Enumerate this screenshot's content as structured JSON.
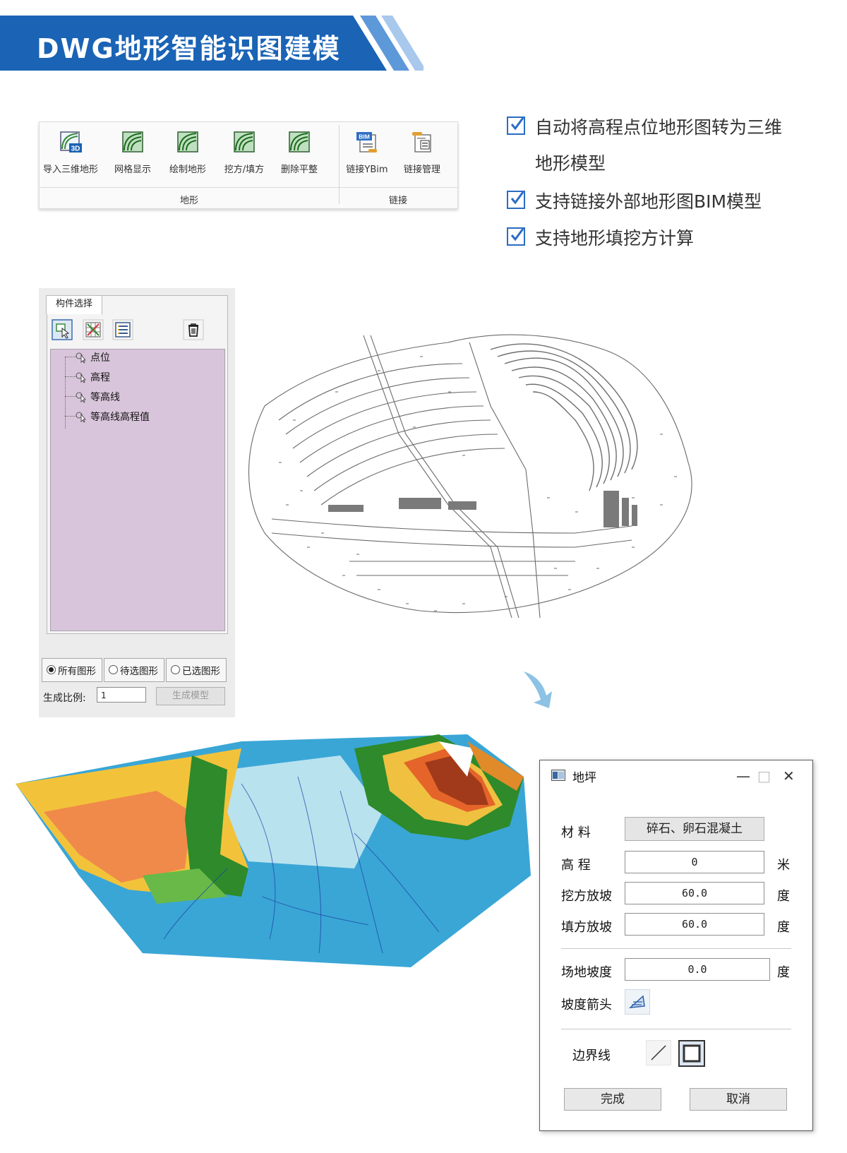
{
  "header": {
    "title": "DWG地形智能识图建模",
    "color": "#1a63b5"
  },
  "ribbon": {
    "groups": [
      {
        "label": "地形",
        "buttons": [
          {
            "label": "导入三维地形",
            "icon": "import-3d-terrain-icon"
          },
          {
            "label": "网格显示",
            "icon": "grid-display-icon"
          },
          {
            "label": "绘制地形",
            "icon": "draw-terrain-icon"
          },
          {
            "label": "挖方/填方",
            "icon": "cut-fill-icon"
          },
          {
            "label": "删除平整",
            "icon": "delete-leveling-icon"
          }
        ]
      },
      {
        "label": "链接",
        "buttons": [
          {
            "label": "链接YBim",
            "icon": "link-ybim-icon"
          },
          {
            "label": "链接管理",
            "icon": "link-manage-icon"
          }
        ]
      }
    ],
    "import_icon_text": "3D",
    "bim_icon_text": "BIM"
  },
  "features": [
    {
      "line1": "自动将高程点位地形图转为三维",
      "line2": "地形模型"
    },
    {
      "line1": "支持链接外部地形图BIM模型"
    },
    {
      "line1": "支持地形填挖方计算"
    }
  ],
  "panel": {
    "tab": "构件选择",
    "tree": [
      "点位",
      "高程",
      "等高线",
      "等高线高程值"
    ],
    "radios": [
      {
        "label": "所有图形",
        "checked": true
      },
      {
        "label": "待选图形",
        "checked": false
      },
      {
        "label": "已选图形",
        "checked": false
      }
    ],
    "scale_label": "生成比例:",
    "scale_value": "1",
    "generate_button": "生成模型"
  },
  "dialog": {
    "title": "地坪",
    "material_label": "材  料",
    "material_value": "碎石、卵石混凝土",
    "elevation_label": "高  程",
    "elevation_value": "0",
    "elevation_unit": "米",
    "cut_slope_label": "挖方放坡",
    "cut_slope_value": "60.0",
    "cut_slope_unit": "度",
    "fill_slope_label": "填方放坡",
    "fill_slope_value": "60.0",
    "fill_slope_unit": "度",
    "site_slope_label": "场地坡度",
    "site_slope_value": "0.0",
    "site_slope_unit": "度",
    "slope_arrow_label": "坡度箭头",
    "boundary_label": "边界线",
    "ok_button": "完成",
    "cancel_button": "取消"
  }
}
